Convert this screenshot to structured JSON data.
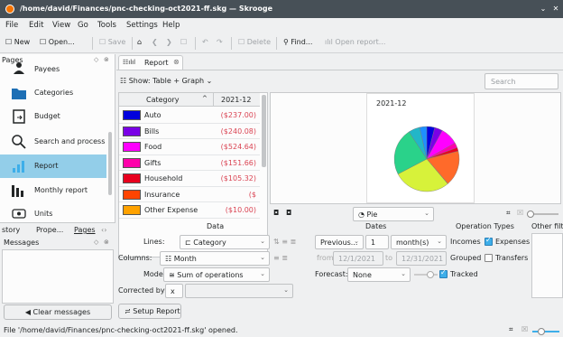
{
  "window": {
    "title": "/home/david/Finances/pnc-checking-oct2021-ff.skg — Skrooge",
    "minimize": "⌄",
    "close": "✕"
  },
  "menu": [
    "File",
    "Edit",
    "View",
    "Go",
    "Tools",
    "Settings",
    "Help"
  ],
  "toolbar": {
    "new": "☐ New",
    "open": "☐ Open...",
    "save": "☐ Save",
    "home": "⌂",
    "back": "❮",
    "forward": "❯",
    "bookmark": "☐",
    "undo": "↶",
    "redo": "↷",
    "delete": "☐ Delete",
    "find": "⚲ Find...",
    "open_report": "ılıl Open report..."
  },
  "left_panel": {
    "header": "Pages",
    "items": [
      {
        "label": "Payees"
      },
      {
        "label": "Categories"
      },
      {
        "label": "Budget"
      },
      {
        "label": "Search and process"
      },
      {
        "label": "Report",
        "selected": true
      },
      {
        "label": "Monthly report"
      },
      {
        "label": "Units"
      }
    ],
    "bottom_tabs": [
      "story",
      "Prope...",
      "Pages"
    ],
    "messages_header": "Messages",
    "clear_messages": "Clear messages"
  },
  "report_tab": {
    "label": "Report",
    "close": "⊗"
  },
  "show": {
    "label": "Show: Table + Graph",
    "search_placeholder": "Search"
  },
  "table": {
    "col_category": "Category",
    "col_period": "2021-12",
    "rows": [
      {
        "category": "Auto",
        "amount": "($237.00)",
        "color": "#0000dd"
      },
      {
        "category": "Bills",
        "amount": "($240.08)",
        "color": "#7a00e6"
      },
      {
        "category": "Food",
        "amount": "($524.64)",
        "color": "#ff00ff"
      },
      {
        "category": "Gifts",
        "amount": "($151.66)",
        "color": "#ff00aa"
      },
      {
        "category": "Household",
        "amount": "($105.32)",
        "color": "#e8001e"
      },
      {
        "category": "Insurance",
        "amount": "($",
        "color": "#ff4400"
      },
      {
        "category": "Other Expense",
        "amount": "($10.00)",
        "color": "#ffa200"
      }
    ]
  },
  "chart_data": {
    "type": "pie",
    "title": "2021-12",
    "slices": [
      {
        "label": "Auto",
        "color": "#0000dd",
        "value": 237.0
      },
      {
        "label": "Bills",
        "color": "#7a00e6",
        "value": 240.08
      },
      {
        "label": "Food",
        "color": "#ff00ff",
        "value": 524.64
      },
      {
        "label": "Gifts",
        "color": "#ff00aa",
        "value": 151.66
      },
      {
        "label": "Household",
        "color": "#e8001e",
        "value": 105.32
      },
      {
        "label": "Insurance",
        "color": "#ff6a2a",
        "value": 1050
      },
      {
        "label": "Other Expense",
        "color": "#ffa200",
        "value": 10.0
      },
      {
        "label": "",
        "color": "#d7f23a",
        "value": 1700
      },
      {
        "label": "",
        "color": "#2ad28a",
        "value": 1400
      },
      {
        "label": "",
        "color": "#22b6c8",
        "value": 340
      },
      {
        "label": "",
        "color": "#1e90ff",
        "value": 210
      }
    ]
  },
  "chart_controls": {
    "type": "◔ Pie"
  },
  "setup": {
    "data_header": "Data",
    "dates_header": "Dates",
    "optypes_header": "Operation Types",
    "other_header": "Other filte",
    "lines_label": "Lines:",
    "lines_value": "⊏ Category",
    "columns_label": "Columns:",
    "columns_value": "☷ Month",
    "mode_label": "Mode:",
    "mode_value": "≅ Sum of operations",
    "corrected_label": "Corrected by:",
    "corrected_value": "x",
    "period_value": "Previous...",
    "count_value": "1",
    "unit_value": "month(s)",
    "from_label": "from",
    "from_value": "12/1/2021",
    "to_label": "to",
    "to_value": "12/31/2021",
    "forecast_label": "Forecast:",
    "forecast_value": "None",
    "incomes": "Incomes",
    "expenses": "Expenses",
    "grouped": "Grouped",
    "transfers": "Transfers",
    "tracked": "Tracked",
    "setup_report": "Setup Report"
  },
  "status": "File '/home/david/Finances/pnc-checking-oct2021-ff.skg' opened."
}
